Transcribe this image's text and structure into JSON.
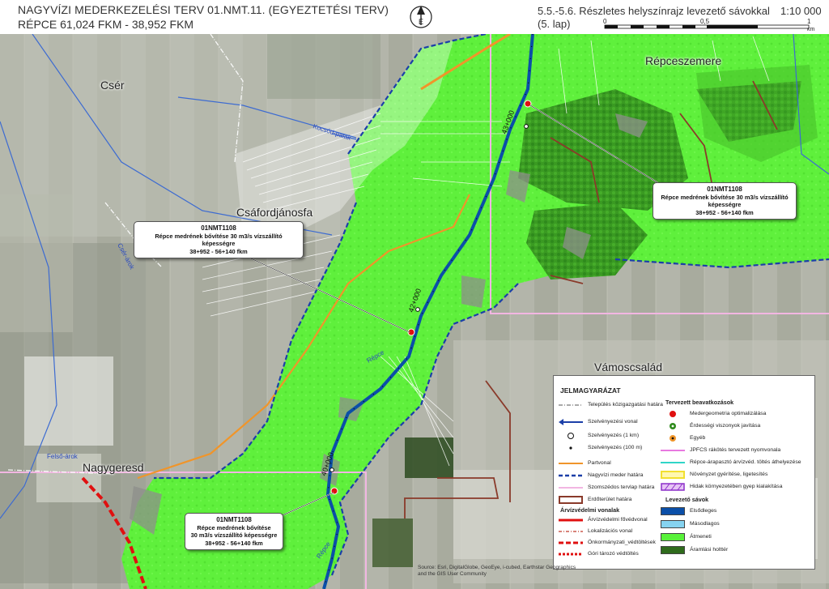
{
  "header": {
    "title_line1": "NAGYVÍZI MEDERKEZELÉSI TERV 01.NMT.11. (EGYEZTETÉSI TERV)",
    "title_line2": "RÉPCE 61,024 FKM - 38,952 FKM",
    "sheet_line1": "5.5.-5.6. Részletes helyszínrajz levezető sávokkal",
    "sheet_line2": "(5. lap)",
    "scale": "1:10 000",
    "scalebar_ticks": [
      "0",
      "0,5",
      "1"
    ],
    "scalebar_unit": "km",
    "north_label": "É"
  },
  "places": {
    "cser": "Csér",
    "csafordjanosfa": "Csáfordjánosfa",
    "repceszemere": "Répceszemere",
    "vamoscsalad": "Vámoscsalád",
    "nagygeresd": "Nagygeresd"
  },
  "streams": {
    "kocsod": "Kocsód-patak",
    "cser_arok": "Csér-árok",
    "felso_arok": "Felső-árok",
    "repce": "Répce"
  },
  "chainage": {
    "c43": "43+000",
    "c42": "42+000",
    "c40": "40+000"
  },
  "callouts": [
    {
      "code": "01NMT1108",
      "line1": "Répce medrének bővítése 30 m3/s vízszállító képességre",
      "line2": "38+952 - 56+140 fkm"
    },
    {
      "code": "01NMT1108",
      "line1": "Répce medrének bővítése 30 m3/s vízszállító képességre",
      "line2": "38+952 - 56+140 fkm"
    },
    {
      "code": "01NMT1108",
      "line1": "Répce medrének bővítése",
      "line1b": "30 m3/s vízszállító képességre",
      "line2": "38+952 - 56+140 fkm"
    }
  ],
  "legend": {
    "title": "JELMAGYARÁZAT",
    "left_items": [
      {
        "label": "Település közigazgatási határa",
        "symbol": "admin-boundary"
      },
      {
        "label": "Szelvényezési vonal",
        "symbol": "chainage-line"
      },
      {
        "label": "Szelvényezés (1 km)",
        "symbol": "km-circle"
      },
      {
        "label": "Szelvényezés (100 m)",
        "symbol": "dot-small"
      },
      {
        "label": "Partvonal",
        "symbol": "shoreline"
      },
      {
        "label": "Nagyvízi meder határa",
        "symbol": "floodbed-boundary"
      },
      {
        "label": "Szomszédos tervlap határa",
        "symbol": "adjacent-sheet"
      },
      {
        "label": "Erdőterület határa",
        "symbol": "forest-boundary"
      }
    ],
    "levee_heading": "Árvízvédelmi vonalak",
    "levee_items": [
      {
        "label": "Árvízvédelmi fővédvonal",
        "symbol": "main-levee"
      },
      {
        "label": "Lokalizációs vonal",
        "symbol": "localization-line"
      },
      {
        "label": "Önkormányzati_védtöltések",
        "symbol": "municipal-levee"
      },
      {
        "label": "Góri tározó védtöltés",
        "symbol": "reservoir-levee"
      }
    ],
    "planned_heading": "Tervezett beavatkozások",
    "planned_items": [
      {
        "label": "Medergeometria optimalizálása",
        "symbol": "red-dot"
      },
      {
        "label": "Érdességi viszonyok javítása",
        "symbol": "green-dot"
      },
      {
        "label": "Egyéb",
        "symbol": "orange-dot"
      },
      {
        "label": "JPFCS rákötés tervezett nyomvonala",
        "symbol": "pink-line"
      },
      {
        "label": "Répce-árapasztó árvízvéd. töltés áthelyezése",
        "symbol": "cyan-line"
      },
      {
        "label": "Növényzet gyérítése, ligetesítés",
        "symbol": "yellow-box"
      },
      {
        "label": "Hidak környezetében gyep kialakítása",
        "symbol": "purple-hatch"
      }
    ],
    "belts_heading": "Levezető sávok",
    "belt_items": [
      {
        "label": "Elsődleges",
        "color": "#0b4fa8"
      },
      {
        "label": "Másodlagos",
        "color": "#86d3f0"
      },
      {
        "label": "Átmeneti",
        "color": "#58f23a"
      },
      {
        "label": "Áramlási holttér",
        "color": "#2f6b1c"
      }
    ]
  },
  "source": {
    "line1": "Source: Esri, DigitalGlobe, GeoEye, i-cubed, Earthstar Geographics",
    "line2": "and the GIS User Community"
  },
  "colors": {
    "transition_belt": "#58f23a",
    "flow_deadzone": "#2f6b1c",
    "primary_belt": "#0b4fa8",
    "floodbed_boundary": "#1b3fa8",
    "main_levee": "#e01010",
    "shoreline": "#f0952a",
    "forest_boundary": "#8a3a2a",
    "adjacent_sheet": "#f2b6e2"
  }
}
